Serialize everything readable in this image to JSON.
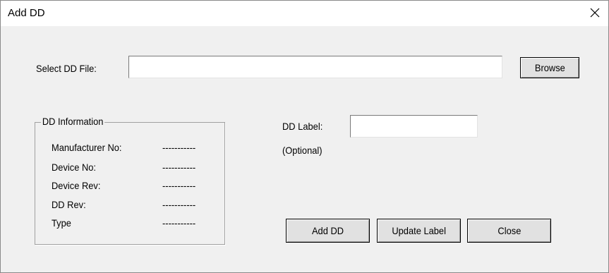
{
  "window": {
    "title": "Add DD"
  },
  "select_file": {
    "label": "Select DD File:",
    "value": "",
    "browse_label": "Browse"
  },
  "dd_info": {
    "title": "DD Information",
    "rows": [
      {
        "label": "Manufacturer No:",
        "value": "-----------"
      },
      {
        "label": "Device No:",
        "value": "-----------"
      },
      {
        "label": "Device Rev:",
        "value": "-----------"
      },
      {
        "label": "DD Rev:",
        "value": "-----------"
      },
      {
        "label": "Type",
        "value": "-----------"
      }
    ]
  },
  "dd_label": {
    "label": "DD Label:",
    "hint": "(Optional)",
    "value": ""
  },
  "buttons": {
    "add": "Add DD",
    "update": "Update Label",
    "close": "Close"
  },
  "icons": {
    "close": "close-icon"
  }
}
